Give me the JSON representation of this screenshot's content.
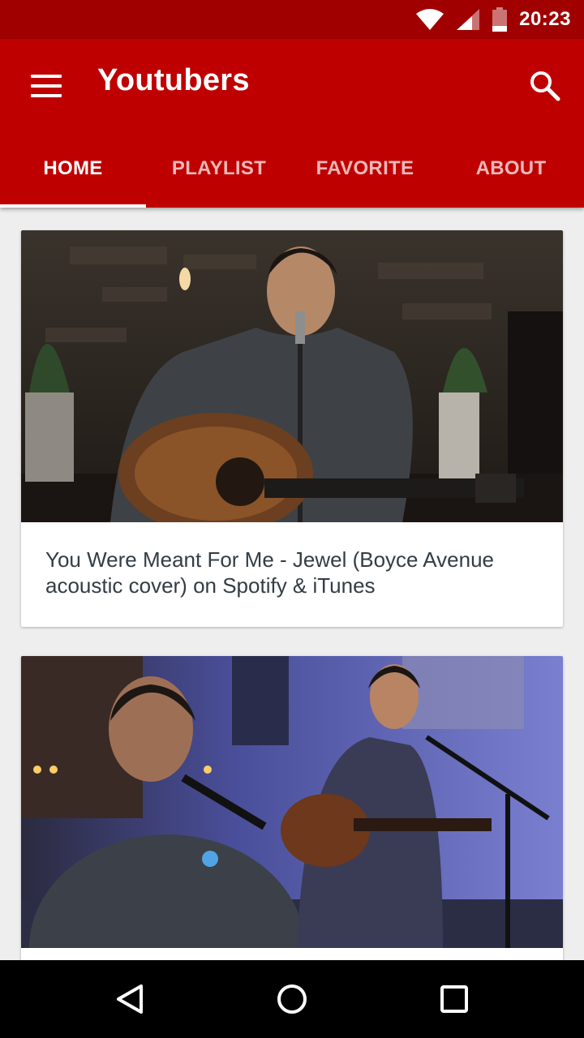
{
  "status_bar": {
    "time": "20:23",
    "icons": [
      "wifi-icon",
      "signal-icon",
      "battery-icon"
    ]
  },
  "app_bar": {
    "title": "Youtubers",
    "menu_icon": "hamburger-menu-icon",
    "search_icon": "search-icon",
    "background": "#bf0000",
    "status_background": "#a00000"
  },
  "tabs": [
    {
      "label": "HOME",
      "active": true
    },
    {
      "label": "PLAYLIST",
      "active": false
    },
    {
      "label": "FAVORITE",
      "active": false
    },
    {
      "label": "ABOUT",
      "active": false
    }
  ],
  "videos": [
    {
      "title": "You Were Meant For Me - Jewel (Boyce Avenue acoustic cover) on Spotify & iTunes"
    },
    {
      "title": ""
    }
  ],
  "nav_bar": {
    "icons": [
      "back-triangle-icon",
      "home-circle-icon",
      "recents-square-icon"
    ]
  }
}
